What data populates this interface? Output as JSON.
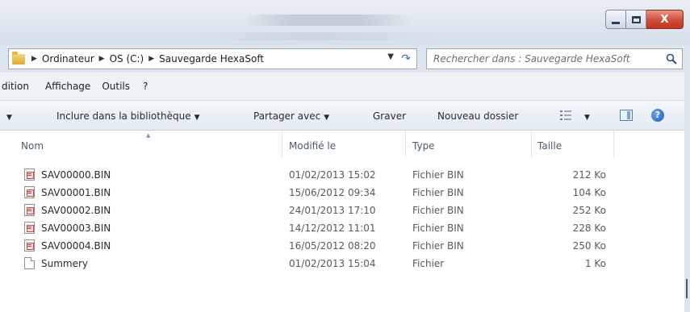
{
  "window": {
    "close_label": "X"
  },
  "address": {
    "crumbs": [
      "Ordinateur",
      "OS (C:)",
      "Sauvegarde HexaSoft"
    ],
    "search_placeholder": "Rechercher dans : Sauvegarde HexaSoft"
  },
  "menu": {
    "items": [
      "dition",
      "Affichage",
      "Outils",
      "?"
    ]
  },
  "toolbar": {
    "include_label": "Inclure dans la bibliothèque",
    "share_label": "Partager avec",
    "burn_label": "Graver",
    "new_folder_label": "Nouveau dossier",
    "help_label": "?"
  },
  "columns": {
    "name": "Nom",
    "modified": "Modifié le",
    "type": "Type",
    "size": "Taille"
  },
  "files": [
    {
      "name": "SAV00000.BIN",
      "modified": "01/02/2013 15:02",
      "type": "Fichier BIN",
      "size": "212 Ko",
      "icon": "bin-file-icon"
    },
    {
      "name": "SAV00001.BIN",
      "modified": "15/06/2012 09:34",
      "type": "Fichier BIN",
      "size": "104 Ko",
      "icon": "bin-file-icon"
    },
    {
      "name": "SAV00002.BIN",
      "modified": "24/01/2013 17:10",
      "type": "Fichier BIN",
      "size": "252 Ko",
      "icon": "bin-file-icon"
    },
    {
      "name": "SAV00003.BIN",
      "modified": "14/12/2012 11:01",
      "type": "Fichier BIN",
      "size": "228 Ko",
      "icon": "bin-file-icon"
    },
    {
      "name": "SAV00004.BIN",
      "modified": "16/05/2012 08:20",
      "type": "Fichier BIN",
      "size": "250 Ko",
      "icon": "bin-file-icon"
    },
    {
      "name": "Summery",
      "modified": "01/02/2013 15:04",
      "type": "Fichier",
      "size": "1 Ko",
      "icon": "plain-file-icon"
    }
  ],
  "colors": {
    "chrome": "#dde6ef",
    "close_button": "#cf4c39",
    "link_blue": "#3a6dc2"
  }
}
